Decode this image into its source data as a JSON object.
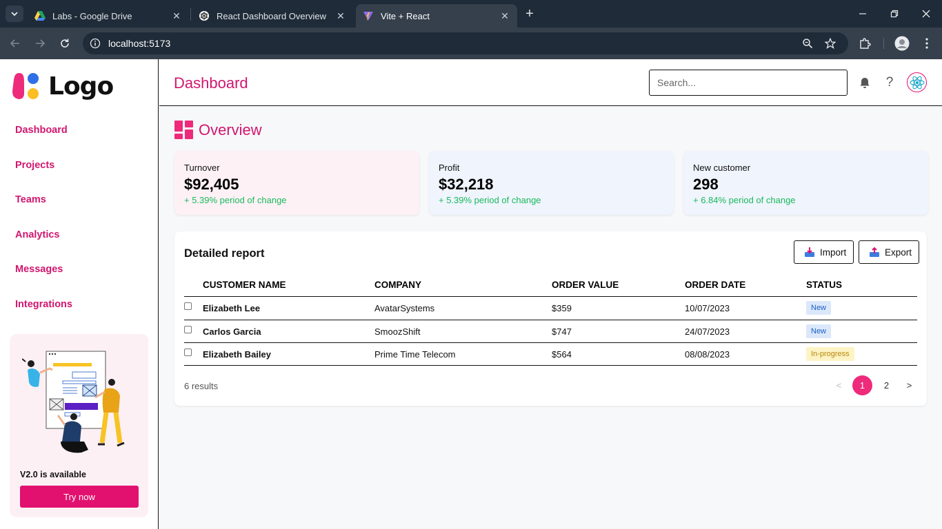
{
  "browser": {
    "tabs": [
      {
        "title": "Labs - Google Drive",
        "favicon": "google-drive-icon"
      },
      {
        "title": "React Dashboard Overview",
        "favicon": "openai-icon"
      },
      {
        "title": "Vite + React",
        "favicon": "vite-icon"
      }
    ],
    "url": "localhost:5173"
  },
  "sidebar": {
    "logo_text": "Logo",
    "items": [
      {
        "label": "Dashboard"
      },
      {
        "label": "Projects"
      },
      {
        "label": "Teams"
      },
      {
        "label": "Analytics"
      },
      {
        "label": "Messages"
      },
      {
        "label": "Integrations"
      }
    ],
    "promo": {
      "text": "V2.0 is available",
      "button": "Try now"
    }
  },
  "header": {
    "title": "Dashboard",
    "search_placeholder": "Search..."
  },
  "overview": {
    "title": "Overview",
    "cards": [
      {
        "label": "Turnover",
        "value": "$92,405",
        "change": "+ 5.39% period of change",
        "bg": "#fdf1f6"
      },
      {
        "label": "Profit",
        "value": "$32,218",
        "change": "+ 5.39% period of change",
        "bg": "#eff4fd"
      },
      {
        "label": "New customer",
        "value": "298",
        "change": "+ 6.84% period of change",
        "bg": "#eff4fd"
      }
    ]
  },
  "report": {
    "title": "Detailed report",
    "import_label": "Import",
    "export_label": "Export",
    "columns": [
      "CUSTOMER NAME",
      "COMPANY",
      "ORDER VALUE",
      "ORDER DATE",
      "STATUS"
    ],
    "rows": [
      {
        "name": "Elizabeth Lee",
        "company": "AvatarSystems",
        "value": "$359",
        "date": "10/07/2023",
        "status": "New"
      },
      {
        "name": "Carlos Garcia",
        "company": "SmoozShift",
        "value": "$747",
        "date": "24/07/2023",
        "status": "New"
      },
      {
        "name": "Elizabeth Bailey",
        "company": "Prime Time Telecom",
        "value": "$564",
        "date": "08/08/2023",
        "status": "In-progress"
      }
    ],
    "results": "6 results",
    "pagination": {
      "prev": "<",
      "pages": [
        "1",
        "2"
      ],
      "next": ">",
      "current": "1"
    }
  },
  "colors": {
    "accent": "#d1166f",
    "button": "#e2116f",
    "positive": "#1bb95c"
  }
}
